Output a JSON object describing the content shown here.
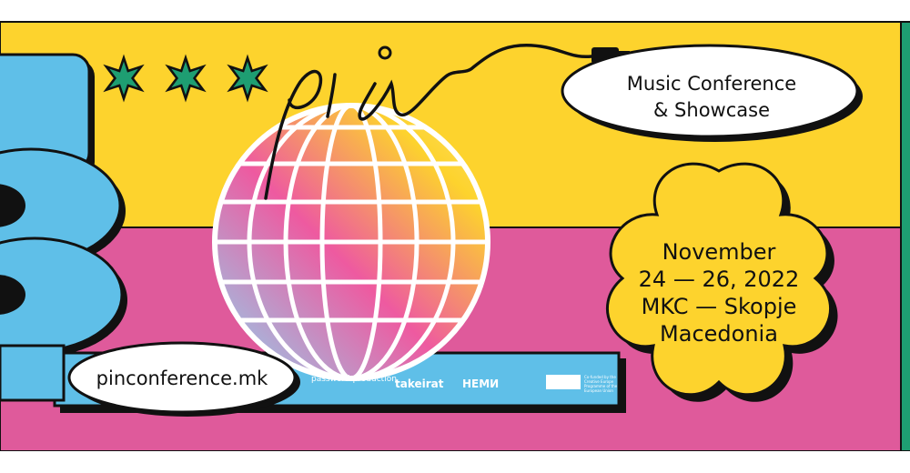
{
  "event": {
    "logo": "pin",
    "asterisks": "✱✱✱",
    "conference_line1": "Music Conference",
    "conference_line2": "& Showcase",
    "date_line1": "November",
    "date_line2": "24 — 26, 2022",
    "date_line3": "MKC — Skopje",
    "date_line4": "Macedonia",
    "website": "pinconference.mk"
  },
  "sponsors": {
    "sponsor1": "password production",
    "sponsor2": "takeirat",
    "sponsor3": "НЕМИ",
    "sponsor4": "Co-funded by the Creative Europe Programme of the European Union"
  },
  "colors": {
    "yellow": "#fdd32d",
    "pink": "#df5a9b",
    "blue": "#5fbfe8",
    "green": "#1e9e72",
    "outline": "#111111"
  },
  "icons": [
    "asterisk-icon",
    "disco-ball-icon",
    "audio-plug-icon",
    "flower-badge-icon",
    "eu-flag-icon"
  ]
}
